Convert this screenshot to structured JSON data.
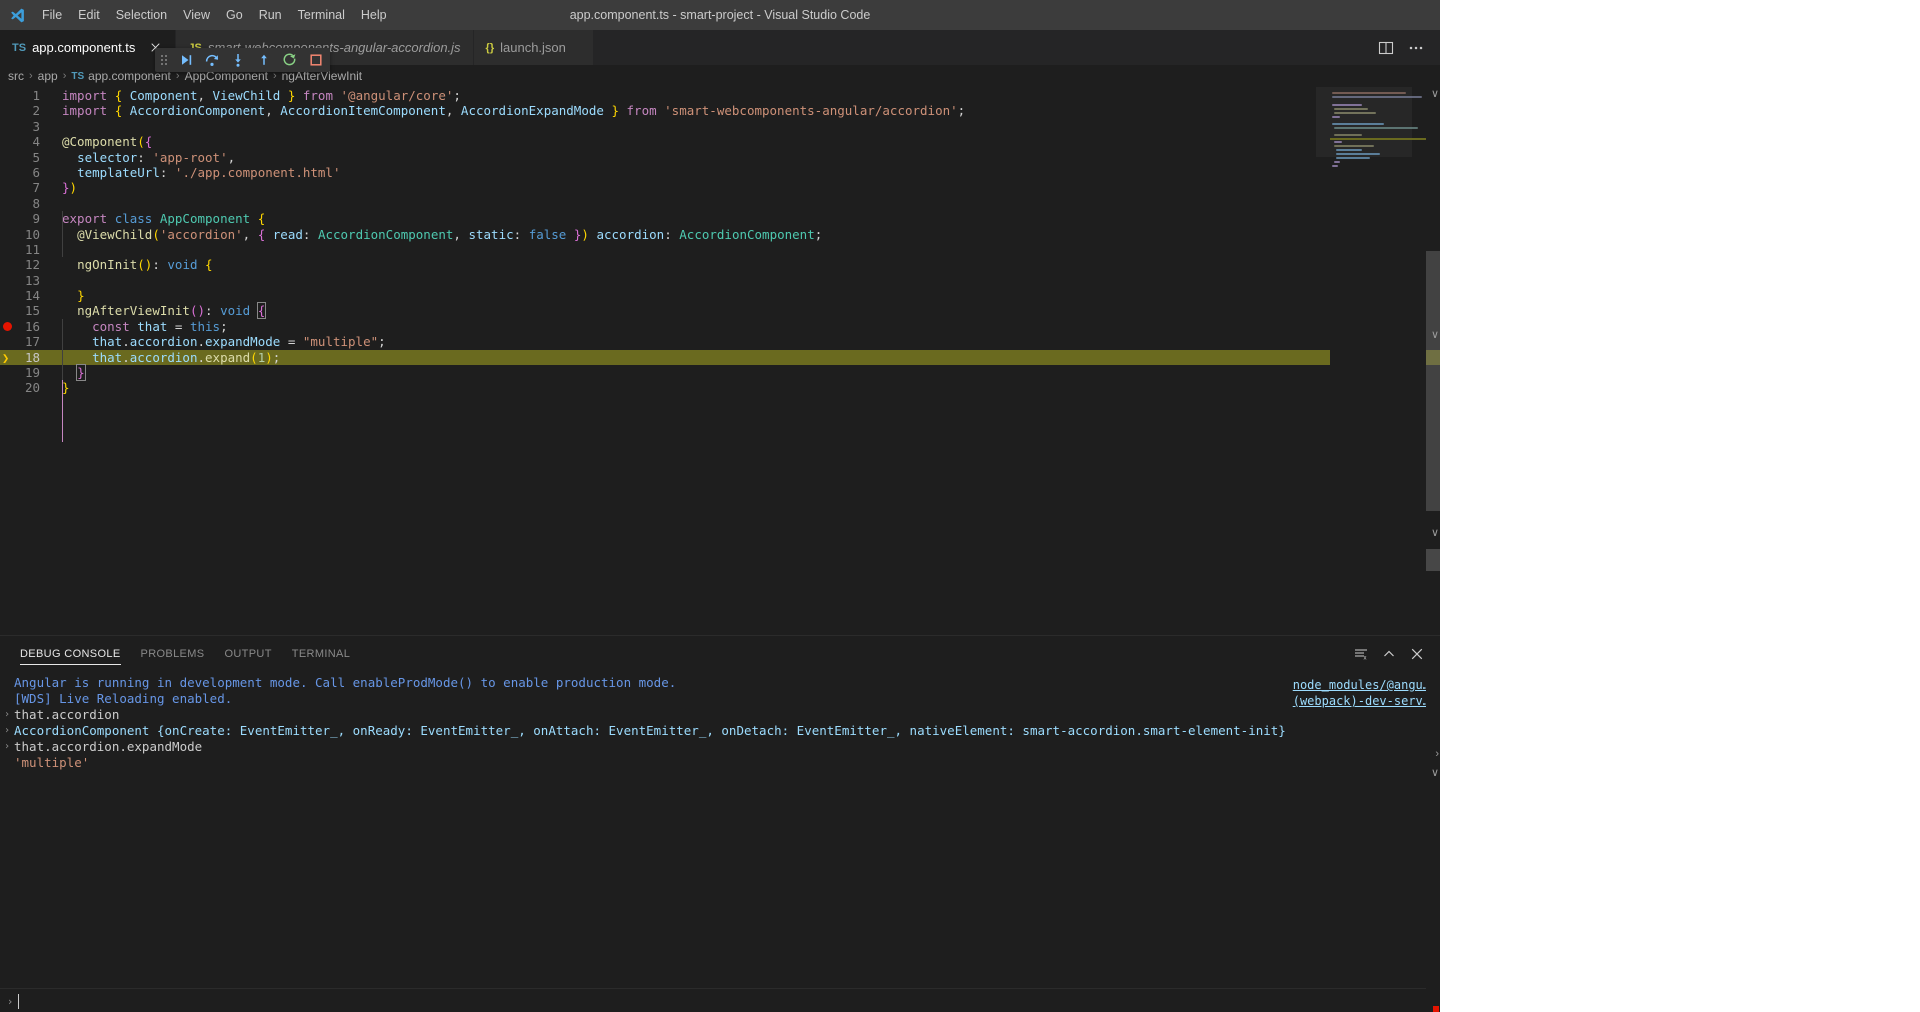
{
  "window": {
    "title": "app.component.ts - smart-project - Visual Studio Code",
    "logo_icon": "vscode-logo-icon"
  },
  "menubar": {
    "items": [
      {
        "label": "File"
      },
      {
        "label": "Edit"
      },
      {
        "label": "Selection"
      },
      {
        "label": "View"
      },
      {
        "label": "Go"
      },
      {
        "label": "Run"
      },
      {
        "label": "Terminal"
      },
      {
        "label": "Help"
      }
    ]
  },
  "tabs": {
    "items": [
      {
        "label": "app.component.ts",
        "icon": "typescript-file-icon",
        "icon_text": "TS",
        "icon_class": "ts",
        "active": true,
        "italic": false,
        "closable": true
      },
      {
        "label": "smart-webcomponents-angular-accordion.js",
        "icon": "javascript-file-icon",
        "icon_text": "JS",
        "icon_class": "js",
        "active": false,
        "italic": true,
        "closable": false
      },
      {
        "label": "launch.json",
        "icon": "json-file-icon",
        "icon_text": "{}",
        "icon_class": "json",
        "active": false,
        "italic": false,
        "closable": false
      }
    ],
    "actions": [
      {
        "name": "split-editor-icon",
        "label": "Split Editor"
      },
      {
        "name": "more-actions-icon",
        "label": "More Actions..."
      }
    ]
  },
  "breadcrumbs": {
    "items": [
      {
        "label": "src",
        "icon": ""
      },
      {
        "label": "app",
        "icon": ""
      },
      {
        "label": "app.component",
        "icon": "TS"
      },
      {
        "label": "AppComponent",
        "icon": ""
      },
      {
        "label": "ngAfterViewInit",
        "icon": ""
      }
    ],
    "separator": "›"
  },
  "debug_toolbar": {
    "buttons": [
      {
        "name": "drag-handle-icon",
        "label": "Drag"
      },
      {
        "name": "continue-icon",
        "label": "Continue"
      },
      {
        "name": "step-over-icon",
        "label": "Step Over"
      },
      {
        "name": "step-into-icon",
        "label": "Step Into"
      },
      {
        "name": "step-out-icon",
        "label": "Step Out"
      },
      {
        "name": "restart-icon",
        "label": "Restart"
      },
      {
        "name": "stop-icon",
        "label": "Stop"
      }
    ]
  },
  "editor": {
    "language": "typescript",
    "breakpoint_line": 16,
    "current_execution_line": 18,
    "lines": [
      {
        "n": 1,
        "html": "<span class=\"kw\">import</span> <span class=\"b1\">{</span> <span class=\"var\">Component</span><span class=\"pun\">,</span> <span class=\"var\">ViewChild</span> <span class=\"b1\">}</span> <span class=\"kw\">from</span> <span class=\"str\">'@angular/core'</span><span class=\"pun\">;</span>"
      },
      {
        "n": 2,
        "html": "<span class=\"kw\">import</span> <span class=\"b1\">{</span> <span class=\"var\">AccordionComponent</span><span class=\"pun\">,</span> <span class=\"var\">AccordionItemComponent</span><span class=\"pun\">,</span> <span class=\"var\">AccordionExpandMode</span> <span class=\"b1\">}</span> <span class=\"kw\">from</span> <span class=\"str\">'smart-webcomponents-angular/accordion'</span><span class=\"pun\">;</span>"
      },
      {
        "n": 3,
        "html": ""
      },
      {
        "n": 4,
        "html": "<span class=\"dec\">@Component</span><span class=\"b1\">(</span><span class=\"b2\">{</span>"
      },
      {
        "n": 5,
        "html": "  <span class=\"var\">selector</span><span class=\"pun\">:</span> <span class=\"str\">'app-root'</span><span class=\"pun\">,</span>"
      },
      {
        "n": 6,
        "html": "  <span class=\"var\">templateUrl</span><span class=\"pun\">:</span> <span class=\"str\">'./app.component.html'</span>"
      },
      {
        "n": 7,
        "html": "<span class=\"b2\">}</span><span class=\"b1\">)</span>"
      },
      {
        "n": 8,
        "html": ""
      },
      {
        "n": 9,
        "html": "<span class=\"kw\">export</span> <span class=\"kw2\">class</span> <span class=\"typ\">AppComponent</span> <span class=\"b1\">{</span>"
      },
      {
        "n": 10,
        "html": "  <span class=\"dec\">@ViewChild</span><span class=\"b1\">(</span><span class=\"str\">'accordion'</span><span class=\"pun\">,</span> <span class=\"b2\">{</span> <span class=\"var\">read</span><span class=\"pun\">:</span> <span class=\"typ\">AccordionComponent</span><span class=\"pun\">,</span> <span class=\"var\">static</span><span class=\"pun\">:</span> <span class=\"kw2\">false</span> <span class=\"b2\">}</span><span class=\"b1\">)</span> <span class=\"var\">accordion</span><span class=\"pun\">:</span> <span class=\"typ\">AccordionComponent</span><span class=\"pun\">;</span>"
      },
      {
        "n": 11,
        "html": ""
      },
      {
        "n": 12,
        "html": "  <span class=\"fn\">ngOnInit</span><span class=\"b1\">()</span><span class=\"pun\">:</span> <span class=\"kw2\">void</span> <span class=\"b1\">{</span>"
      },
      {
        "n": 13,
        "html": ""
      },
      {
        "n": 14,
        "html": "  <span class=\"b1\">}</span>"
      },
      {
        "n": 15,
        "html": "  <span class=\"fn\">ngAfterViewInit</span><span class=\"b2\">()</span><span class=\"pun\">:</span> <span class=\"kw2\">void</span> <span class=\"b2 cursor-bracket\">{</span>"
      },
      {
        "n": 16,
        "html": "    <span class=\"kw\">const</span> <span class=\"var\">that</span> <span class=\"pun\">=</span> <span class=\"kw2\">this</span><span class=\"pun\">;</span>"
      },
      {
        "n": 17,
        "html": "    <span class=\"var\">that</span><span class=\"pun\">.</span><span class=\"var\">accordion</span><span class=\"pun\">.</span><span class=\"var\">expandMode</span> <span class=\"pun\">=</span> <span class=\"str\">\"multiple\"</span><span class=\"pun\">;</span>"
      },
      {
        "n": 18,
        "html": "    <span class=\"var\">that</span><span class=\"pun\">.</span><span class=\"var\">accordion</span><span class=\"pun\">.</span><span class=\"fn\">expand</span><span class=\"b1\">(</span><span class=\"num\">1</span><span class=\"b1\">)</span><span class=\"pun\">;</span>"
      },
      {
        "n": 19,
        "html": "  <span class=\"b2 cursor-bracket\">}</span>"
      },
      {
        "n": 20,
        "html": "<span class=\"b1\">}</span>"
      }
    ]
  },
  "panel": {
    "tabs": [
      {
        "label": "DEBUG CONSOLE",
        "active": true
      },
      {
        "label": "PROBLEMS",
        "active": false
      },
      {
        "label": "OUTPUT",
        "active": false
      },
      {
        "label": "TERMINAL",
        "active": false
      }
    ],
    "actions": [
      {
        "name": "clear-console-icon",
        "label": "Clear Console"
      },
      {
        "name": "maximize-panel-icon",
        "label": "Maximize Panel Size"
      },
      {
        "name": "close-panel-icon",
        "label": "Close Panel"
      }
    ],
    "console_rows": [
      {
        "gutter": "",
        "text": "Angular is running in development mode. Call enableProdMode() to enable production mode.",
        "style": "info"
      },
      {
        "gutter": "",
        "text": "[WDS] Live Reloading enabled.",
        "style": "info"
      },
      {
        "gutter": "›",
        "text": "that.accordion",
        "style": "plain"
      },
      {
        "gutter": "›",
        "text": "AccordionComponent {onCreate: EventEmitter_, onReady: EventEmitter_, onAttach: EventEmitter_, onDetach: EventEmitter_, nativeElement: smart-accordion.smart-element-init}",
        "style": "obj"
      },
      {
        "gutter": "›",
        "text": "that.accordion.expandMode",
        "style": "plain"
      },
      {
        "gutter": "",
        "text": "'multiple'",
        "style": "str"
      }
    ],
    "source_links": [
      {
        "label": "node_modules/@angu…"
      },
      {
        "label": "(webpack)-dev-serv…"
      }
    ],
    "input_prompt": "›",
    "input_value": ""
  },
  "colors": {
    "editor_bg": "#1e1e1e",
    "titlebar_bg": "#3c3c3c",
    "tab_active_bg": "#1e1e1e",
    "tab_inactive_bg": "#2d2d2d",
    "breakpoint_red": "#e51400",
    "debug_line_highlight": "#6a6a1f",
    "accent_blue": "#519aba",
    "current_line_arrow": "#ffcc00"
  }
}
